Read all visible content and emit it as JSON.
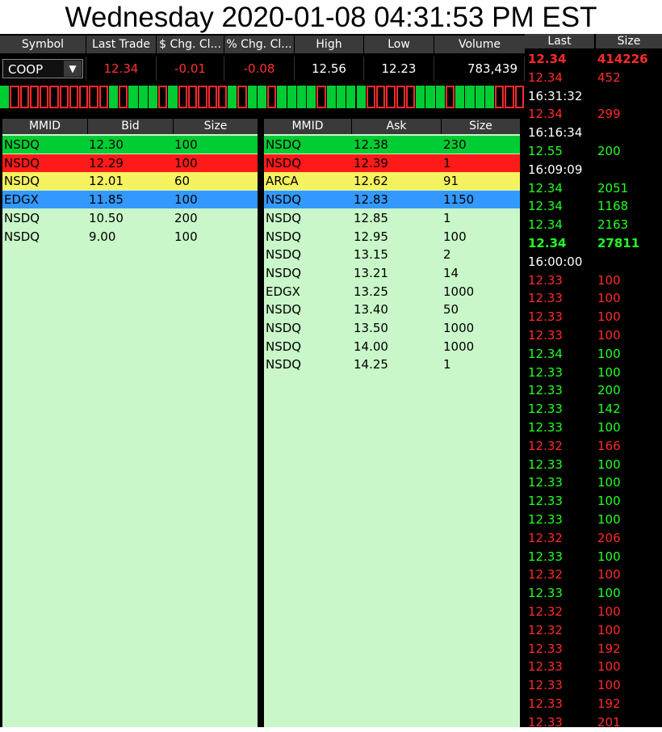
{
  "title": "Wednesday 2020-01-08 04:31:53 PM EST",
  "colors": {
    "green": "#00cc33",
    "red": "#ff1a1a",
    "yellow": "#f5f260",
    "blue": "#3399ff",
    "light_green_bg": "#c9f7c9",
    "header_gray": "#3a3a3a"
  },
  "quote": {
    "headers": [
      "Symbol",
      "Last Trade",
      "$ Chg. Cl...",
      "% Chg. Cl...",
      "High",
      "Low",
      "Volume"
    ],
    "symbol": "COOP",
    "symbol_dropdown_icon": "chevron-down-icon",
    "last_trade": "12.34",
    "chg_dollar": "-0.01",
    "chg_pct": "-0.08",
    "high": "12.56",
    "low": "12.23",
    "volume": "783,439"
  },
  "tick_bar": [
    "g",
    "r",
    "r",
    "r",
    "r",
    "r",
    "r",
    "r",
    "r",
    "r",
    "r",
    "g",
    "r",
    "g",
    "g",
    "g",
    "r",
    "g",
    "r",
    "r",
    "r",
    "r",
    "r",
    "g",
    "r",
    "g",
    "g",
    "r",
    "g",
    "g",
    "g",
    "g",
    "r",
    "g",
    "g",
    "g",
    "g",
    "r",
    "r",
    "r",
    "r",
    "r",
    "g",
    "g",
    "g",
    "r",
    "g",
    "g",
    "g",
    "g",
    "r",
    "r",
    "r"
  ],
  "bid": {
    "headers": [
      "MMID",
      "Bid",
      "Size"
    ],
    "rows": [
      {
        "mmid": "NSDQ",
        "price": "12.30",
        "size": "100",
        "level": "green"
      },
      {
        "mmid": "NSDQ",
        "price": "12.29",
        "size": "100",
        "level": "red"
      },
      {
        "mmid": "NSDQ",
        "price": "12.01",
        "size": "60",
        "level": "yellow"
      },
      {
        "mmid": "EDGX",
        "price": "11.85",
        "size": "100",
        "level": "blue"
      },
      {
        "mmid": "NSDQ",
        "price": "10.50",
        "size": "200",
        "level": "none"
      },
      {
        "mmid": "NSDQ",
        "price": "9.00",
        "size": "100",
        "level": "none"
      }
    ]
  },
  "ask": {
    "headers": [
      "MMID",
      "Ask",
      "Size"
    ],
    "rows": [
      {
        "mmid": "NSDQ",
        "price": "12.38",
        "size": "230",
        "level": "green"
      },
      {
        "mmid": "NSDQ",
        "price": "12.39",
        "size": "1",
        "level": "red"
      },
      {
        "mmid": "ARCA",
        "price": "12.62",
        "size": "91",
        "level": "yellow"
      },
      {
        "mmid": "NSDQ",
        "price": "12.83",
        "size": "1150",
        "level": "blue"
      },
      {
        "mmid": "NSDQ",
        "price": "12.85",
        "size": "1",
        "level": "none"
      },
      {
        "mmid": "NSDQ",
        "price": "12.95",
        "size": "100",
        "level": "none"
      },
      {
        "mmid": "NSDQ",
        "price": "13.15",
        "size": "2",
        "level": "none"
      },
      {
        "mmid": "NSDQ",
        "price": "13.21",
        "size": "14",
        "level": "none"
      },
      {
        "mmid": "EDGX",
        "price": "13.25",
        "size": "1000",
        "level": "none"
      },
      {
        "mmid": "NSDQ",
        "price": "13.40",
        "size": "50",
        "level": "none"
      },
      {
        "mmid": "NSDQ",
        "price": "13.50",
        "size": "1000",
        "level": "none"
      },
      {
        "mmid": "NSDQ",
        "price": "14.00",
        "size": "1000",
        "level": "none"
      },
      {
        "mmid": "NSDQ",
        "price": "14.25",
        "size": "1",
        "level": "none"
      }
    ]
  },
  "time_sales": {
    "headers": [
      "Last",
      "Size"
    ],
    "rows": [
      {
        "kind": "trade",
        "price": "12.34",
        "size": "414226",
        "color": "red",
        "bold": true
      },
      {
        "kind": "trade",
        "price": "12.34",
        "size": "452",
        "color": "red",
        "bold": false
      },
      {
        "kind": "time",
        "time": "16:31:32"
      },
      {
        "kind": "trade",
        "price": "12.34",
        "size": "299",
        "color": "red",
        "bold": false
      },
      {
        "kind": "time",
        "time": "16:16:34"
      },
      {
        "kind": "trade",
        "price": "12.55",
        "size": "200",
        "color": "green",
        "bold": false
      },
      {
        "kind": "time",
        "time": "16:09:09"
      },
      {
        "kind": "trade",
        "price": "12.34",
        "size": "2051",
        "color": "green",
        "bold": false
      },
      {
        "kind": "trade",
        "price": "12.34",
        "size": "1168",
        "color": "green",
        "bold": false
      },
      {
        "kind": "trade",
        "price": "12.34",
        "size": "2163",
        "color": "green",
        "bold": false
      },
      {
        "kind": "trade",
        "price": "12.34",
        "size": "27811",
        "color": "green",
        "bold": true
      },
      {
        "kind": "time",
        "time": "16:00:00"
      },
      {
        "kind": "trade",
        "price": "12.33",
        "size": "100",
        "color": "red",
        "bold": false
      },
      {
        "kind": "trade",
        "price": "12.33",
        "size": "100",
        "color": "red",
        "bold": false
      },
      {
        "kind": "trade",
        "price": "12.33",
        "size": "100",
        "color": "red",
        "bold": false
      },
      {
        "kind": "trade",
        "price": "12.33",
        "size": "100",
        "color": "red",
        "bold": false
      },
      {
        "kind": "trade",
        "price": "12.34",
        "size": "100",
        "color": "green",
        "bold": false
      },
      {
        "kind": "trade",
        "price": "12.33",
        "size": "100",
        "color": "green",
        "bold": false
      },
      {
        "kind": "trade",
        "price": "12.33",
        "size": "200",
        "color": "green",
        "bold": false
      },
      {
        "kind": "trade",
        "price": "12.33",
        "size": "142",
        "color": "green",
        "bold": false
      },
      {
        "kind": "trade",
        "price": "12.33",
        "size": "100",
        "color": "green",
        "bold": false
      },
      {
        "kind": "trade",
        "price": "12.32",
        "size": "166",
        "color": "red",
        "bold": false
      },
      {
        "kind": "trade",
        "price": "12.33",
        "size": "100",
        "color": "green",
        "bold": false
      },
      {
        "kind": "trade",
        "price": "12.33",
        "size": "100",
        "color": "green",
        "bold": false
      },
      {
        "kind": "trade",
        "price": "12.33",
        "size": "100",
        "color": "green",
        "bold": false
      },
      {
        "kind": "trade",
        "price": "12.33",
        "size": "100",
        "color": "green",
        "bold": false
      },
      {
        "kind": "trade",
        "price": "12.32",
        "size": "206",
        "color": "red",
        "bold": false
      },
      {
        "kind": "trade",
        "price": "12.33",
        "size": "100",
        "color": "green",
        "bold": false
      },
      {
        "kind": "trade",
        "price": "12.32",
        "size": "100",
        "color": "red",
        "bold": false
      },
      {
        "kind": "trade",
        "price": "12.33",
        "size": "100",
        "color": "green",
        "bold": false
      },
      {
        "kind": "trade",
        "price": "12.32",
        "size": "100",
        "color": "red",
        "bold": false
      },
      {
        "kind": "trade",
        "price": "12.32",
        "size": "100",
        "color": "red",
        "bold": false
      },
      {
        "kind": "trade",
        "price": "12.33",
        "size": "192",
        "color": "red",
        "bold": false
      },
      {
        "kind": "trade",
        "price": "12.33",
        "size": "100",
        "color": "red",
        "bold": false
      },
      {
        "kind": "trade",
        "price": "12.33",
        "size": "100",
        "color": "red",
        "bold": false
      },
      {
        "kind": "trade",
        "price": "12.33",
        "size": "192",
        "color": "red",
        "bold": false
      },
      {
        "kind": "trade",
        "price": "12.33",
        "size": "201",
        "color": "red",
        "bold": false
      }
    ]
  }
}
